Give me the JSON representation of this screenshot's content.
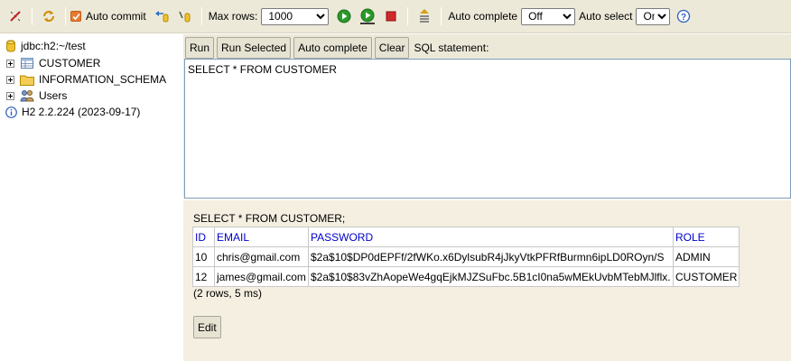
{
  "toolbar": {
    "auto_commit_label": "Auto commit",
    "max_rows_label": "Max rows:",
    "max_rows_value": "1000",
    "auto_complete_label": "Auto complete",
    "auto_complete_value": "Off",
    "auto_select_label": "Auto select",
    "auto_select_value": "On",
    "help_glyph": "?"
  },
  "tree": {
    "connection": "jdbc:h2:~/test",
    "items": [
      {
        "label": "CUSTOMER",
        "icon": "table-icon"
      },
      {
        "label": "INFORMATION_SCHEMA",
        "icon": "folder-icon"
      },
      {
        "label": "Users",
        "icon": "users-icon"
      }
    ],
    "version": "H2 2.2.224 (2023-09-17)"
  },
  "buttons": {
    "run": "Run",
    "run_selected": "Run Selected",
    "auto_complete": "Auto complete",
    "clear": "Clear",
    "sql_label": "SQL statement:"
  },
  "sql_text": "SELECT * FROM CUSTOMER",
  "result": {
    "statement": "SELECT * FROM CUSTOMER;",
    "columns": [
      "ID",
      "EMAIL",
      "PASSWORD",
      "ROLE"
    ],
    "rows": [
      [
        "10",
        "chris@gmail.com",
        "$2a$10$DP0dEPFf/2fWKo.x6DylsubR4jJkyVtkPFRfBurmn6ipLD0ROyn/S",
        "ADMIN"
      ],
      [
        "12",
        "james@gmail.com",
        "$2a$10$83vZhAopeWe4gqEjkMJZSuFbc.5B1cI0na5wMEkUvbMTebMJlflx.",
        "CUSTOMER"
      ]
    ],
    "row_info": "(2 rows, 5 ms)",
    "edit_label": "Edit"
  },
  "colors": {
    "toolbar_bg": "#ece9d8",
    "result_bg": "#f4efe1",
    "header_text": "#0000cc",
    "checkbox": "#e8792f"
  }
}
